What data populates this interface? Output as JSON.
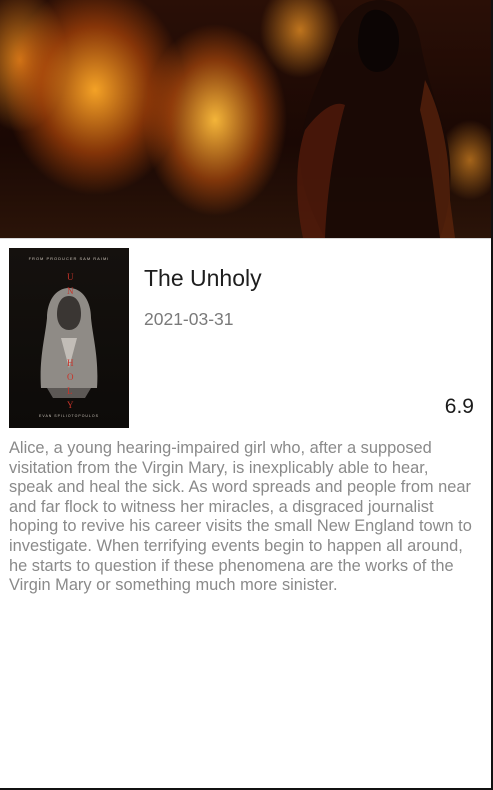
{
  "movie": {
    "title": "The Unholy",
    "release_date": "2021-03-31",
    "rating": "6.9",
    "overview": "Alice, a young hearing-impaired girl who, after a supposed visitation from the Virgin Mary, is inexplicably able to hear, speak and heal the sick. As word spreads and people from near and far flock to witness her miracles, a disgraced journalist hoping to revive his career visits the small New England town to investigate. When terrifying events begin to happen all around, he starts to question if these phenomena are the works of the Virgin Mary or something much more sinister."
  },
  "poster": {
    "top_text": "FROM PRODUCER SAM RAIMI",
    "title_letters": [
      "U",
      "N",
      "H",
      "O",
      "L",
      "Y"
    ],
    "bottom_text": "EVAN SPILIOTOPOULOS"
  },
  "colors": {
    "title": "#1e1e1e",
    "secondary_text": "#7a7a7a",
    "overview_text": "#8a8a8a",
    "poster_letter_accent": "#c8342a"
  }
}
